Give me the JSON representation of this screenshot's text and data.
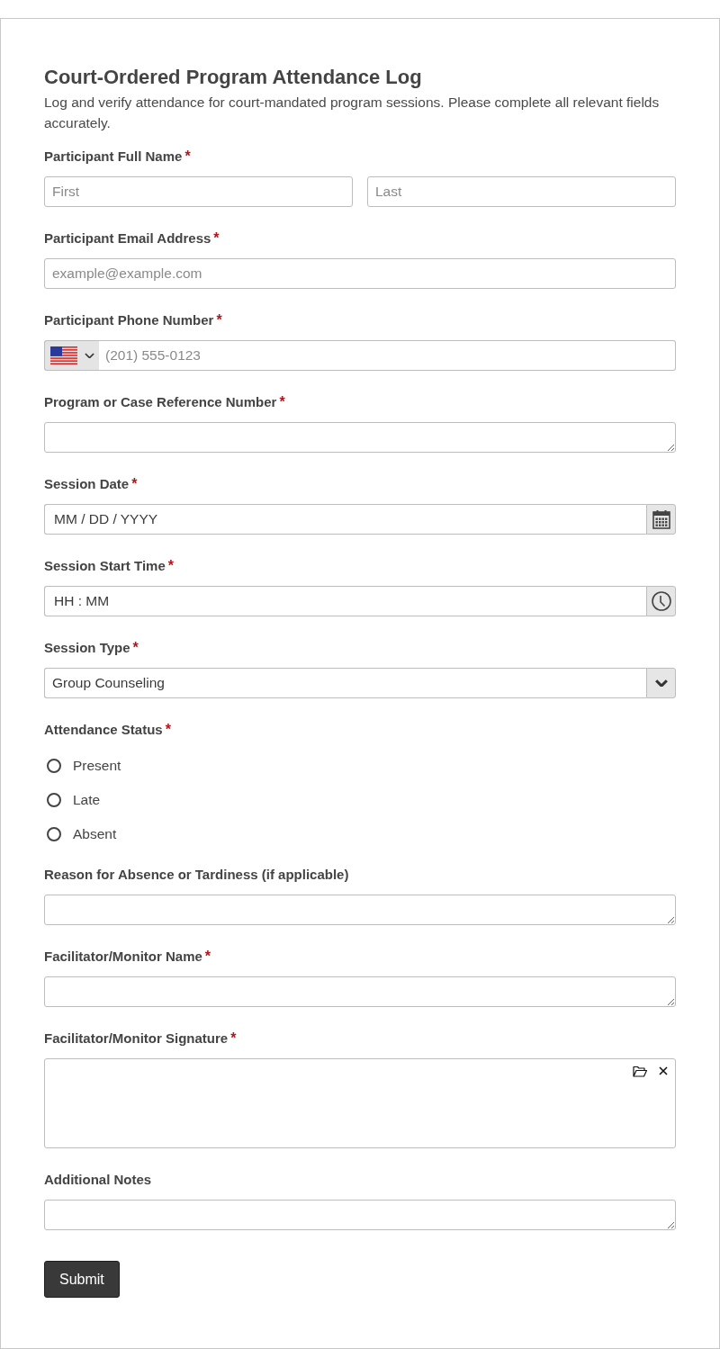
{
  "form": {
    "title": "Court-Ordered Program Attendance Log",
    "description": "Log and verify attendance for court-mandated program sessions. Please complete all relevant fields accurately."
  },
  "fields": [
    {
      "kind": "name",
      "label": "Participant Full Name",
      "required_mark": "*",
      "parts": [
        {
          "placeholder": "First"
        },
        {
          "placeholder": "Last"
        }
      ]
    },
    {
      "kind": "text",
      "label": "Participant Email Address",
      "required_mark": "*",
      "placeholder": "example@example.com"
    },
    {
      "kind": "phone",
      "label": "Participant Phone Number",
      "required_mark": "*",
      "placeholder": "(201) 555-0123"
    },
    {
      "kind": "textarea",
      "label": "Program or Case Reference Number",
      "required_mark": "*"
    },
    {
      "kind": "date",
      "label": "Session Date",
      "required_mark": "*",
      "placeholder": "MM / DD / YYYY"
    },
    {
      "kind": "time",
      "label": "Session Start Time",
      "required_mark": "*",
      "placeholder": "HH : MM"
    },
    {
      "kind": "select",
      "label": "Session Type",
      "required_mark": "*",
      "value": "Group Counseling"
    },
    {
      "kind": "radio",
      "label": "Attendance Status",
      "required_mark": "*",
      "options": [
        {
          "label": "Present",
          "selected": false
        },
        {
          "label": "Late",
          "selected": false
        },
        {
          "label": "Absent",
          "selected": false
        }
      ]
    },
    {
      "kind": "textarea",
      "label": "Reason for Absence or Tardiness (if applicable)"
    },
    {
      "kind": "textarea",
      "label": "Facilitator/Monitor Name",
      "required_mark": "*"
    },
    {
      "kind": "signature",
      "label": "Facilitator/Monitor Signature",
      "required_mark": "*"
    },
    {
      "kind": "textarea",
      "label": "Additional Notes"
    }
  ],
  "submit": {
    "label": "Submit"
  }
}
